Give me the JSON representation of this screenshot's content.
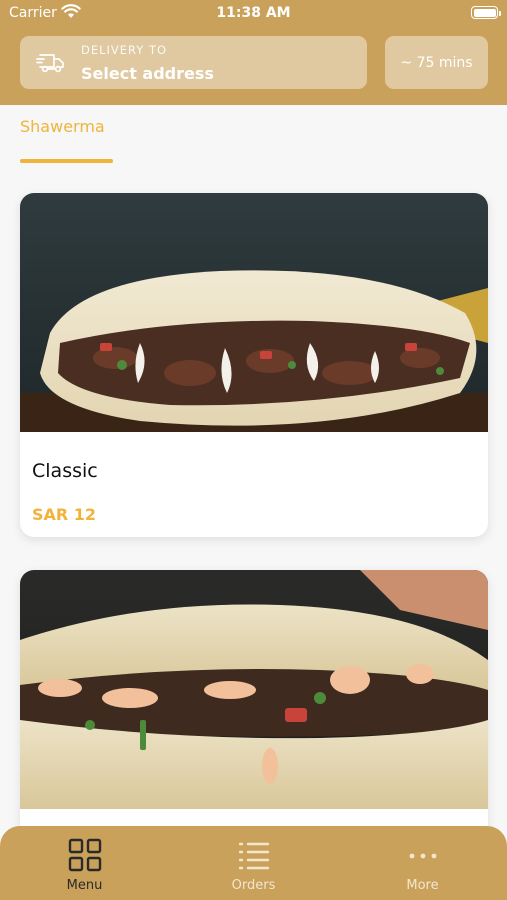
{
  "status_bar": {
    "carrier": "Carrier",
    "time": "11:38 AM"
  },
  "delivery": {
    "label": "DELIVERY TO",
    "value": "Select address",
    "icon": "truck-icon"
  },
  "eta": "~ 75 mins",
  "category_tab": {
    "label": "Shawerma",
    "color": "#f0b43a"
  },
  "products": [
    {
      "name": "Classic",
      "price": "SAR 12"
    },
    {
      "name": "",
      "price": ""
    }
  ],
  "nav": [
    {
      "label": "Menu",
      "icon": "grid-icon",
      "active": true
    },
    {
      "label": "Orders",
      "icon": "list-icon",
      "active": false
    },
    {
      "label": "More",
      "icon": "more-dots-icon",
      "active": false
    }
  ],
  "colors": {
    "brand": "#c9a15a",
    "accent": "#f0b43a",
    "nav_active": "#2a2a2a",
    "nav_inactive": "#f3e6cf"
  }
}
